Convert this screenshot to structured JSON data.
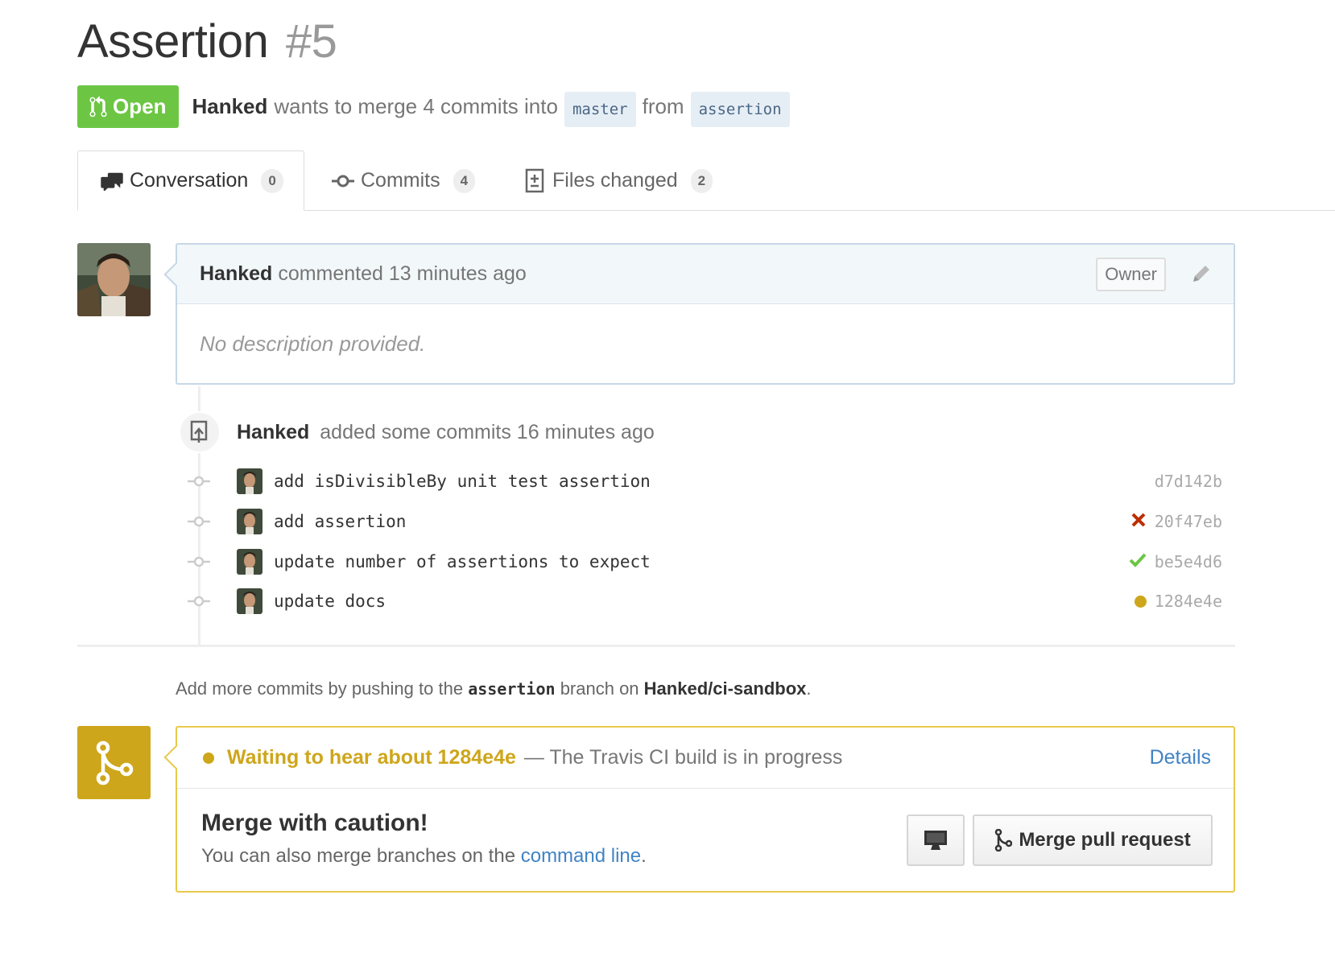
{
  "pr": {
    "title": "Assertion",
    "number": "#5",
    "state_label": "Open",
    "author": "Hanked",
    "merge_text": "wants to merge 4 commits into",
    "base_branch": "master",
    "from_text": "from",
    "head_branch": "assertion"
  },
  "tabs": [
    {
      "label": "Conversation",
      "count": "0",
      "icon": "comment-discussion-icon",
      "active": true
    },
    {
      "label": "Commits",
      "count": "4",
      "icon": "git-commit-icon",
      "active": false
    },
    {
      "label": "Files changed",
      "count": "2",
      "icon": "file-diff-icon",
      "active": false
    }
  ],
  "comment": {
    "author": "Hanked",
    "action": "commented 13 minutes ago",
    "badge": "Owner",
    "body": "No description provided."
  },
  "commit_event": {
    "author": "Hanked",
    "action": "added some commits 16 minutes ago"
  },
  "commits": [
    {
      "message": "add isDivisibleBy unit test assertion",
      "sha": "d7d142b",
      "status": "none"
    },
    {
      "message": "add assertion",
      "sha": "20f47eb",
      "status": "failure"
    },
    {
      "message": "update number of assertions to expect",
      "sha": "be5e4d6",
      "status": "success"
    },
    {
      "message": "update docs",
      "sha": "1284e4e",
      "status": "pending"
    }
  ],
  "push_info": {
    "prefix": "Add more commits by pushing to the",
    "branch": "assertion",
    "middle": "branch on",
    "repo": "Hanked/ci-sandbox",
    "suffix": "."
  },
  "merge": {
    "waiting": "Waiting to hear about 1284e4e",
    "status_text": "— The Travis CI build is in progress",
    "details_link": "Details",
    "heading": "Merge with caution!",
    "sub_prefix": "You can also merge branches on the",
    "sub_link": "command line",
    "sub_suffix": ".",
    "merge_button": "Merge pull request"
  },
  "colors": {
    "open_green": "#6cc644",
    "pending_yellow": "#cea61b",
    "failure_red": "#bd2c00",
    "success_green": "#6cc644",
    "link_blue": "#4183c4"
  }
}
